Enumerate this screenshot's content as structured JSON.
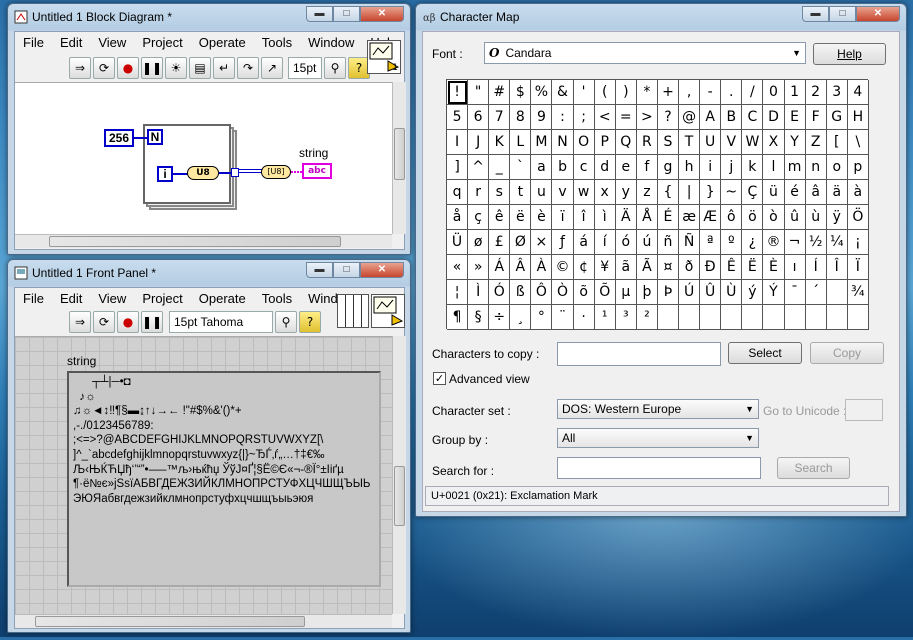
{
  "block_diagram": {
    "title": "Untitled 1 Block Diagram *",
    "menu": [
      "File",
      "Edit",
      "View",
      "Project",
      "Operate",
      "Tools",
      "Window",
      "Help"
    ],
    "font_control": "15pt",
    "icon_number": "1",
    "constant_value": "256",
    "loop_count_terminal": "N",
    "iteration_terminal": "i",
    "u8_node": "U8",
    "string_label": "string",
    "string_indicator": "abc"
  },
  "front_panel": {
    "title": "Untitled 1 Front Panel *",
    "menu": [
      "File",
      "Edit",
      "View",
      "Project",
      "Operate",
      "Tools",
      "Window"
    ],
    "font_control": "15pt Tahoma",
    "string_label": "string",
    "string_lines": [
      "      ┬┴|─•◘",
      "  ♪☼",
      "♫☼◄↕‼¶§▬↨↑↓→← !\"#$%&'()*+",
      ",-./0123456789:",
      ";<=>?@ABCDEFGHIJKLMNOPQRSTUVWXYZ[\\",
      "]^_`abcdefghijklmnopqrstuvwxyz{|}~ЂЃ‚ѓ„…†‡€‰",
      "Љ‹ЊЌЋЏђ‘’“”•–—™љ›њќћџ ЎўЈ¤Ґ¦§Ё©Є«¬-®Ї°±Ііґµ",
      "¶·ё№є»јЅѕїАБВГДЕЖЗИЙКЛМНОПРСТУФХЦЧШЩЪЫЬ",
      "ЭЮЯабвгдежзийклмнопрстуфхцчшщъыьэюя"
    ]
  },
  "char_map": {
    "title": "Character Map",
    "font_label": "Font :",
    "font_value": "Candara",
    "help_button": "Help",
    "characters": [
      "!",
      "\"",
      "#",
      "$",
      "%",
      "&",
      "'",
      "(",
      ")",
      "*",
      "+",
      ",",
      "-",
      ".",
      "/",
      "0",
      "1",
      "2",
      "3",
      "4",
      "5",
      "6",
      "7",
      "8",
      "9",
      ":",
      ";",
      "<",
      "=",
      ">",
      "?",
      "@",
      "A",
      "B",
      "C",
      "D",
      "E",
      "F",
      "G",
      "H",
      "I",
      "J",
      "K",
      "L",
      "M",
      "N",
      "O",
      "P",
      "Q",
      "R",
      "S",
      "T",
      "U",
      "V",
      "W",
      "X",
      "Y",
      "Z",
      "[",
      "\\",
      "]",
      "^",
      "_",
      "`",
      "a",
      "b",
      "c",
      "d",
      "e",
      "f",
      "g",
      "h",
      "i",
      "j",
      "k",
      "l",
      "m",
      "n",
      "o",
      "p",
      "q",
      "r",
      "s",
      "t",
      "u",
      "v",
      "w",
      "x",
      "y",
      "z",
      "{",
      "|",
      "}",
      "~",
      "Ç",
      "ü",
      "é",
      "â",
      "ä",
      "à",
      "å",
      "ç",
      "ê",
      "ë",
      "è",
      "ï",
      "î",
      "ì",
      "Ä",
      "Å",
      "É",
      "æ",
      "Æ",
      "ô",
      "ö",
      "ò",
      "û",
      "ù",
      "ÿ",
      "Ö",
      "Ü",
      "ø",
      "£",
      "Ø",
      "×",
      "ƒ",
      "á",
      "í",
      "ó",
      "ú",
      "ñ",
      "Ñ",
      "ª",
      "º",
      "¿",
      "®",
      "¬",
      "½",
      "¼",
      "¡",
      "«",
      "»",
      "Á",
      "Â",
      "À",
      "©",
      "¢",
      "¥",
      "ã",
      "Ã",
      "¤",
      "ð",
      "Ð",
      "Ê",
      "Ë",
      "È",
      "ı",
      "Í",
      "Î",
      "Ï",
      "¦",
      "Ì",
      "Ó",
      "ß",
      "Ô",
      "Ò",
      "õ",
      "Õ",
      "µ",
      "þ",
      "Þ",
      "Ú",
      "Û",
      "Ù",
      "ý",
      "Ý",
      "¯",
      "´",
      "­",
      "¾",
      "¶",
      "§",
      "÷",
      "¸",
      "°",
      "¨",
      "·",
      "¹",
      "³",
      "²",
      "",
      "",
      "",
      "",
      "",
      "",
      "",
      "",
      "",
      ""
    ],
    "chars_to_copy_label": "Characters to copy :",
    "chars_to_copy_value": "",
    "select_button": "Select",
    "copy_button": "Copy",
    "advanced_view_label": "Advanced view",
    "advanced_view_checked": true,
    "character_set_label": "Character set :",
    "character_set_value": "DOS: Western Europe",
    "goto_unicode_label": "Go to Unicode :",
    "group_by_label": "Group by :",
    "group_by_value": "All",
    "search_for_label": "Search for :",
    "search_button": "Search",
    "status": "U+0021 (0x21): Exclamation Mark"
  }
}
